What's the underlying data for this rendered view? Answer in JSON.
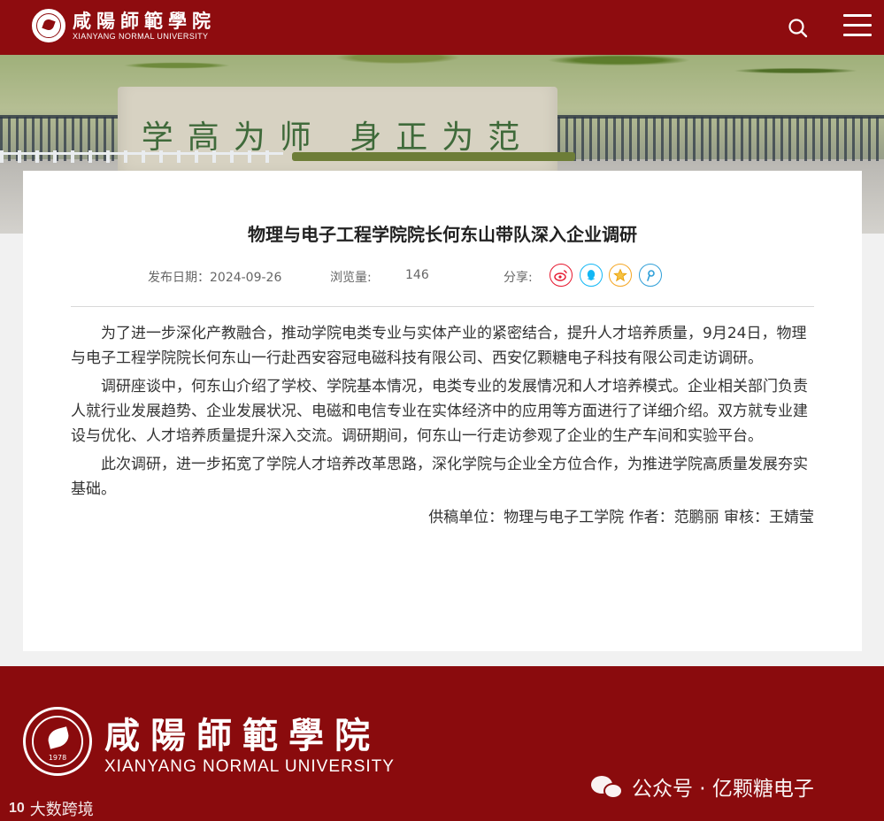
{
  "header": {
    "logo_cn": "咸陽師範學院",
    "logo_en": "XIANYANG NORMAL UNIVERSITY",
    "search_icon": "search-icon",
    "menu_icon": "hamburger-menu-icon",
    "bg_color": "#8e0c0f"
  },
  "banner": {
    "stone_text": "学高为师 身正为范"
  },
  "article": {
    "title": "物理与电子工程学院院长何东山带队深入企业调研",
    "date_label": "发布日期：",
    "date": "2024-09-26",
    "views_label": "浏览量:",
    "views": "146",
    "share_label": "分享:",
    "share_icons": [
      {
        "name": "weibo-icon",
        "color": "#e6162d"
      },
      {
        "name": "qq-icon",
        "color": "#12b7f5"
      },
      {
        "name": "qzone-icon",
        "color": "#f5a623"
      },
      {
        "name": "tencent-weibo-icon",
        "color": "#2f9fd8"
      }
    ],
    "paragraphs": [
      "为了进一步深化产教融合，推动学院电类专业与实体产业的紧密结合，提升人才培养质量，9月24日，物理与电子工程学院院长何东山一行赴西安容冠电磁科技有限公司、西安亿颗糖电子科技有限公司走访调研。",
      "调研座谈中，何东山介绍了学校、学院基本情况，电类专业的发展情况和人才培养模式。企业相关部门负责人就行业发展趋势、企业发展状况、电磁和电信专业在实体经济中的应用等方面进行了详细介绍。双方就专业建设与优化、人才培养质量提升深入交流。调研期间，何东山一行走访参观了企业的生产车间和实验平台。",
      "此次调研，进一步拓宽了学院人才培养改革思路，深化学院与企业全方位合作，为推进学院高质量发展夯实基础。"
    ],
    "source_line": "供稿单位：物理与电子工学院 作者：范鹏丽 审核：王婧莹"
  },
  "footer": {
    "logo_cn": "咸陽師範學院",
    "logo_en": "XIANYANG NORMAL UNIVERSITY",
    "seal_year": "1978",
    "bg_color": "#8a0b0d"
  },
  "watermarks": {
    "wechat": "公众号 · 亿颗糖电子",
    "left_mark": "10",
    "left_text": "大数跨境"
  }
}
